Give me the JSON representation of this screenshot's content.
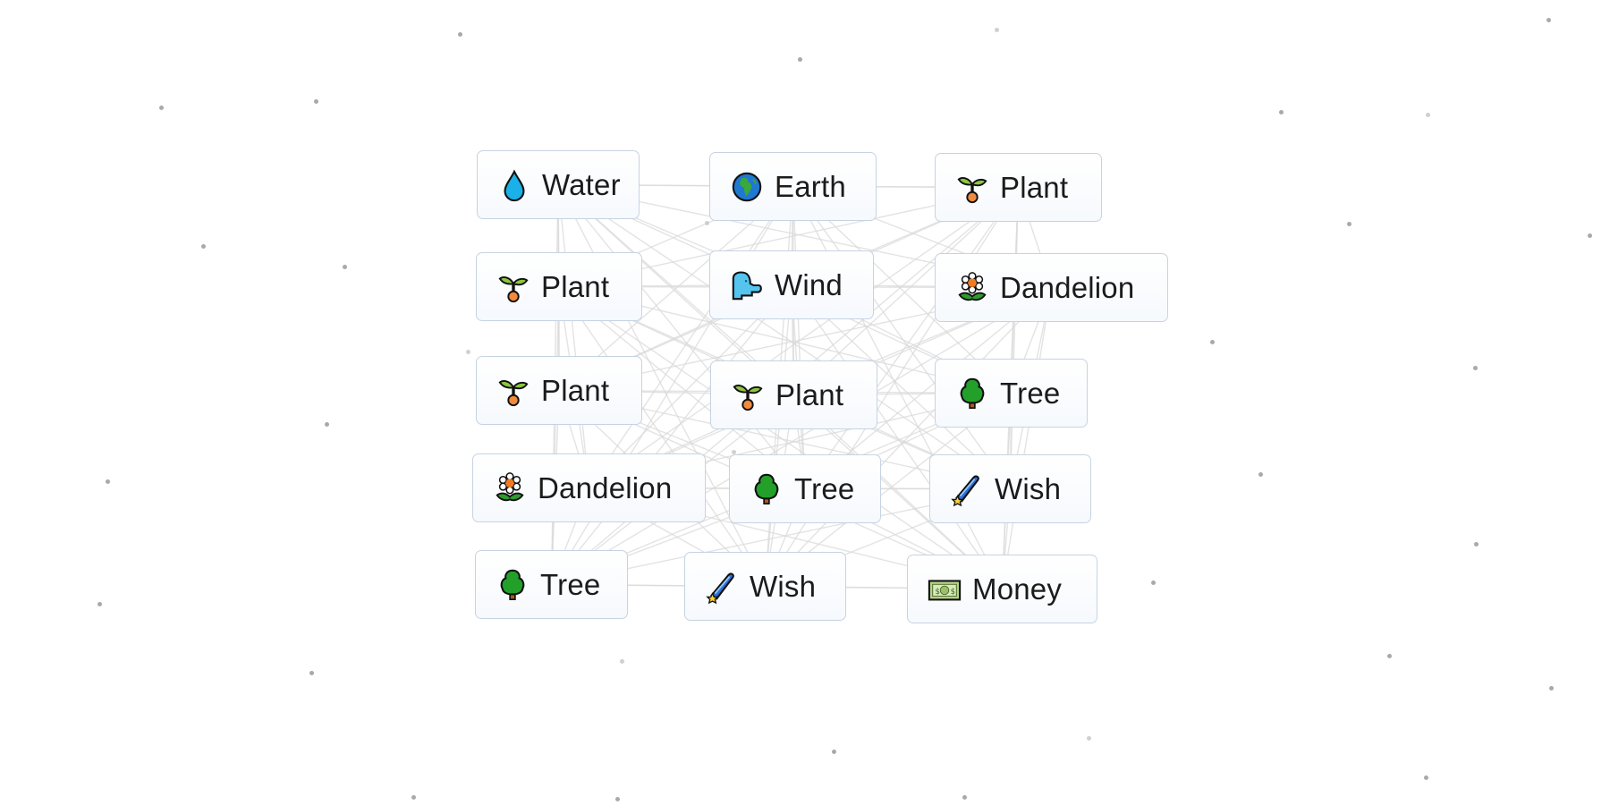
{
  "game": {
    "elements": [
      {
        "label": "Water",
        "icon": "water-drop-icon"
      },
      {
        "label": "Earth",
        "icon": "earth-globe-icon"
      },
      {
        "label": "Plant",
        "icon": "seedling-icon"
      },
      {
        "label": "Plant",
        "icon": "seedling-icon"
      },
      {
        "label": "Wind",
        "icon": "wind-face-icon"
      },
      {
        "label": "Dandelion",
        "icon": "flower-icon"
      },
      {
        "label": "Plant",
        "icon": "seedling-icon"
      },
      {
        "label": "Plant",
        "icon": "seedling-icon"
      },
      {
        "label": "Tree",
        "icon": "tree-icon"
      },
      {
        "label": "Dandelion",
        "icon": "flower-icon"
      },
      {
        "label": "Tree",
        "icon": "tree-icon"
      },
      {
        "label": "Wish",
        "icon": "shooting-star-icon"
      },
      {
        "label": "Tree",
        "icon": "tree-icon"
      },
      {
        "label": "Wish",
        "icon": "shooting-star-icon"
      },
      {
        "label": "Money",
        "icon": "banknote-icon"
      }
    ]
  },
  "colors": {
    "background": "#ffffff",
    "element_border": "#c7d3e2",
    "connection_line": "#d9d9d9",
    "label_text": "#1b1b1b"
  }
}
